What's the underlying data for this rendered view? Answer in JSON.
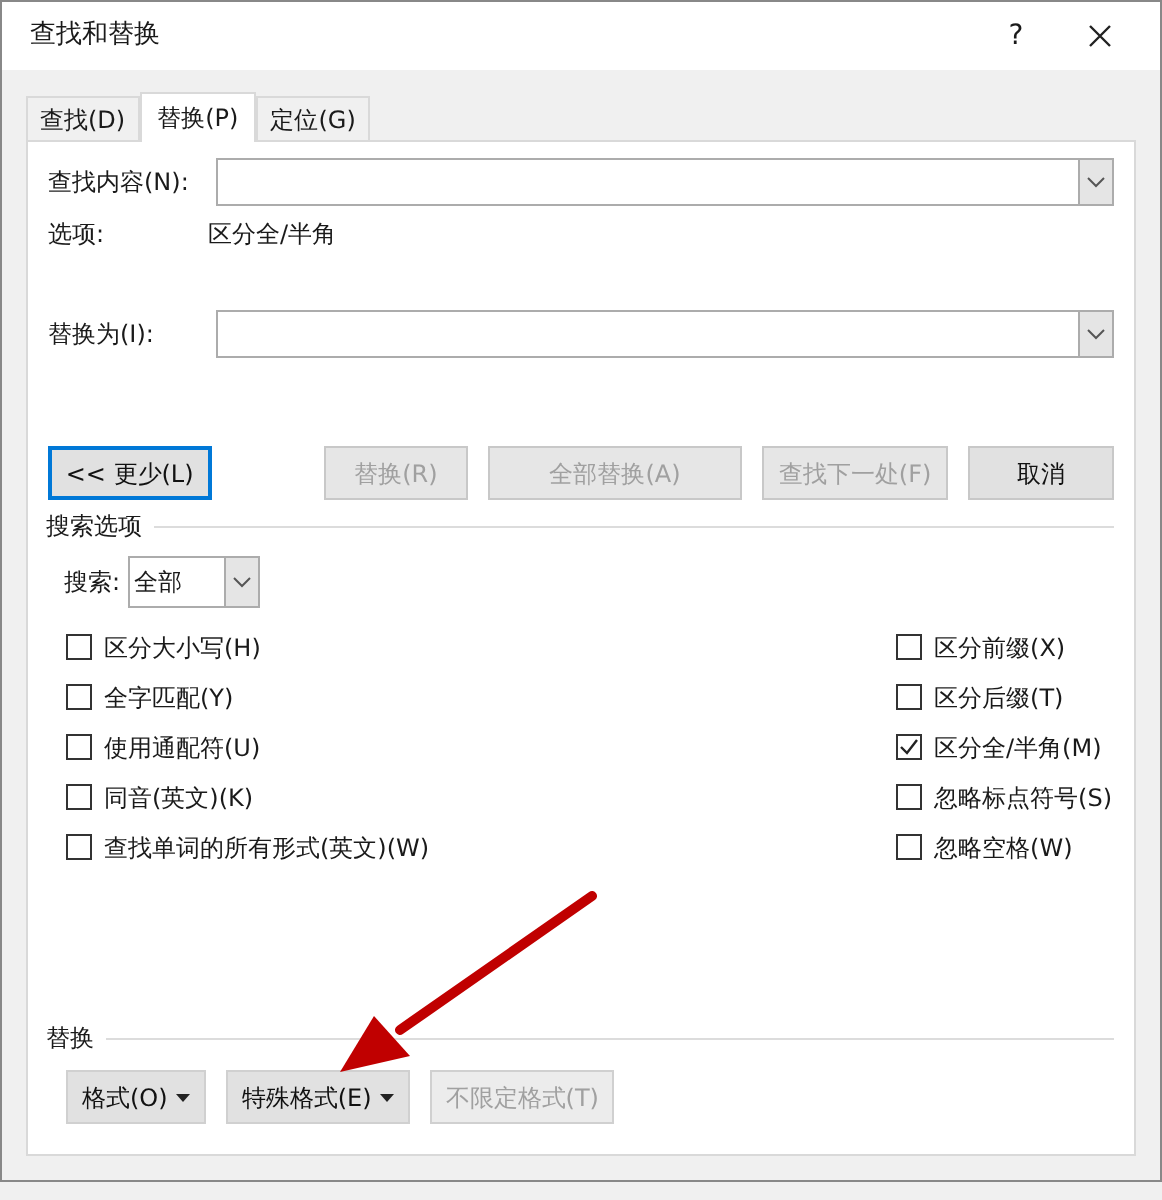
{
  "window": {
    "title": "查找和替换",
    "help": "?"
  },
  "tabs": [
    {
      "label": "查找(D)",
      "selected": false
    },
    {
      "label": "替换(P)",
      "selected": true
    },
    {
      "label": "定位(G)",
      "selected": false
    }
  ],
  "find": {
    "label": "查找内容(N):",
    "options_label": "选项:",
    "options_value": "区分全/半角"
  },
  "replace": {
    "label": "替换为(I):"
  },
  "buttons": [
    {
      "label": "<< 更少(L)",
      "disabled": false,
      "focused": true
    },
    {
      "label": "替换(R)",
      "disabled": true,
      "focused": false
    },
    {
      "label": "全部替换(A)",
      "disabled": true,
      "focused": false
    },
    {
      "label": "查找下一处(F)",
      "disabled": true,
      "focused": false
    },
    {
      "label": "取消",
      "disabled": false,
      "focused": false
    }
  ],
  "search_options": {
    "title": "搜索选项",
    "search_label": "搜索:",
    "search_value": "全部",
    "left": [
      {
        "label": "区分大小写(H)",
        "checked": false
      },
      {
        "label": "全字匹配(Y)",
        "checked": false
      },
      {
        "label": "使用通配符(U)",
        "checked": false
      },
      {
        "label": "同音(英文)(K)",
        "checked": false
      },
      {
        "label": "查找单词的所有形式(英文)(W)",
        "checked": false
      }
    ],
    "right": [
      {
        "label": "区分前缀(X)",
        "checked": false
      },
      {
        "label": "区分后缀(T)",
        "checked": false
      },
      {
        "label": "区分全/半角(M)",
        "checked": true
      },
      {
        "label": "忽略标点符号(S)",
        "checked": false
      },
      {
        "label": "忽略空格(W)",
        "checked": false
      }
    ]
  },
  "replace_section": {
    "title": "替换",
    "buttons": [
      {
        "label": "格式(O)",
        "disabled": false,
        "dropdown": true
      },
      {
        "label": "特殊格式(E)",
        "disabled": false,
        "dropdown": true
      },
      {
        "label": "不限定格式(T)",
        "disabled": true,
        "dropdown": false
      }
    ]
  }
}
